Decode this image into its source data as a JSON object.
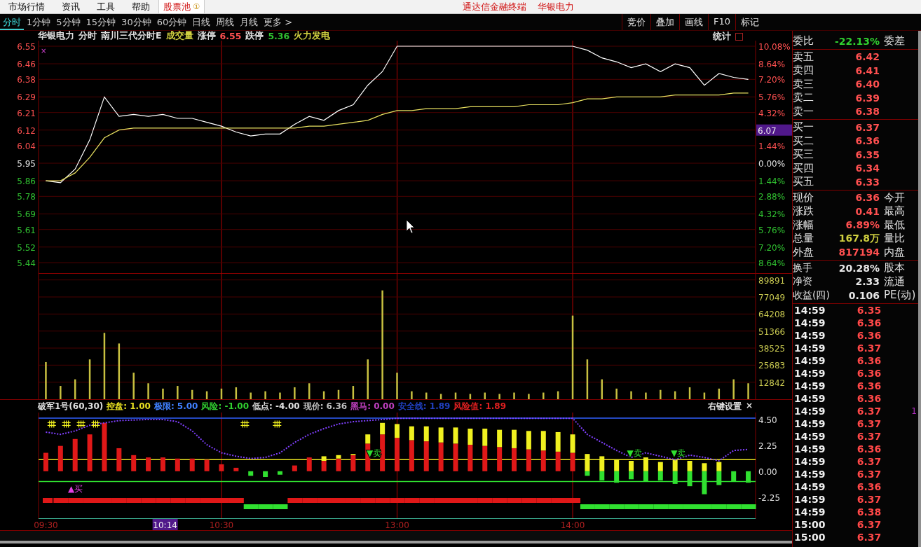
{
  "menu_bar": {
    "items": [
      "市场行情",
      "资讯",
      "工具",
      "帮助"
    ],
    "pool": {
      "label": "股票池",
      "badge": "①"
    },
    "titles": [
      "通达信金融终端",
      "华银电力"
    ]
  },
  "period_tabs": [
    {
      "label": "分时",
      "selected": true
    },
    {
      "label": "1分钟",
      "selected": false
    },
    {
      "label": "5分钟",
      "selected": false
    },
    {
      "label": "15分钟",
      "selected": false
    },
    {
      "label": "30分钟",
      "selected": false
    },
    {
      "label": "60分钟",
      "selected": false
    },
    {
      "label": "日线",
      "selected": false
    },
    {
      "label": "周线",
      "selected": false
    },
    {
      "label": "月线",
      "selected": false
    },
    {
      "label": "更多 >",
      "selected": false
    }
  ],
  "tool_buttons": [
    "竞价",
    "叠加",
    "画线",
    "F10",
    "标记"
  ],
  "chart_header": {
    "items": [
      {
        "text": "华银电力",
        "kind": "label"
      },
      {
        "text": "分时",
        "kind": "label"
      },
      {
        "text": "南川三代分时E",
        "kind": "label"
      },
      {
        "text": "成交量",
        "kind": "volume"
      },
      {
        "text": "涨停",
        "kind": "label"
      },
      {
        "text": "6.55",
        "kind": "up"
      },
      {
        "text": "跌停",
        "kind": "label"
      },
      {
        "text": "5.36",
        "kind": "down"
      },
      {
        "text": "火力发电",
        "kind": "volume"
      }
    ],
    "stats_label": "统计"
  },
  "price_panel": {
    "corner_mark": "×",
    "right_axis": [
      {
        "label": "10.08%",
        "kind": "up"
      },
      {
        "label": "8.64%",
        "kind": "up"
      },
      {
        "label": "7.20%",
        "kind": "up"
      },
      {
        "label": "5.76%",
        "kind": "up"
      },
      {
        "label": "4.32%",
        "kind": "up"
      },
      {
        "label": "6.07",
        "kind": "cursor"
      },
      {
        "label": "1.44%",
        "kind": "up"
      },
      {
        "label": "0.00%",
        "kind": "flat"
      },
      {
        "label": "1.44%",
        "kind": "down"
      },
      {
        "label": "2.88%",
        "kind": "down"
      },
      {
        "label": "4.32%",
        "kind": "down"
      },
      {
        "label": "5.76%",
        "kind": "down"
      },
      {
        "label": "7.20%",
        "kind": "down"
      },
      {
        "label": "8.64%",
        "kind": "down"
      }
    ],
    "chart_data": {
      "type": "line",
      "grid": true,
      "ylim": [
        5.44,
        6.55
      ],
      "yticks": [
        {
          "value": 6.55,
          "label": "6.55"
        },
        {
          "value": 6.46,
          "label": "6.46"
        },
        {
          "value": 6.38,
          "label": "6.38"
        },
        {
          "value": 6.29,
          "label": "6.29"
        },
        {
          "value": 6.21,
          "label": "6.21"
        },
        {
          "value": 6.12,
          "label": "6.12"
        },
        {
          "value": 6.04,
          "label": "6.04"
        },
        {
          "value": 5.95,
          "label": "5.95"
        },
        {
          "value": 5.86,
          "label": "5.86"
        },
        {
          "value": 5.78,
          "label": "5.78"
        },
        {
          "value": 5.69,
          "label": "5.69"
        },
        {
          "value": 5.61,
          "label": "5.61"
        },
        {
          "value": 5.52,
          "label": "5.52"
        },
        {
          "value": 5.44,
          "label": "5.44"
        }
      ],
      "series": [
        {
          "color": "#ffffff",
          "values": [
            5.86,
            5.85,
            5.92,
            6.07,
            6.29,
            6.19,
            6.2,
            6.19,
            6.2,
            6.18,
            6.18,
            6.16,
            6.14,
            6.11,
            6.09,
            6.1,
            6.1,
            6.15,
            6.19,
            6.17,
            6.22,
            6.25,
            6.35,
            6.42,
            6.55,
            6.55,
            6.55,
            6.55,
            6.55,
            6.55,
            6.55,
            6.55,
            6.55,
            6.55,
            6.55,
            6.55,
            6.55,
            6.53,
            6.49,
            6.47,
            6.44,
            6.46,
            6.42,
            6.46,
            6.44,
            6.35,
            6.41,
            6.39,
            6.38
          ]
        },
        {
          "color": "#e8e060",
          "values": [
            5.86,
            5.86,
            5.9,
            5.98,
            6.08,
            6.12,
            6.13,
            6.13,
            6.13,
            6.13,
            6.13,
            6.13,
            6.13,
            6.13,
            6.13,
            6.13,
            6.13,
            6.13,
            6.14,
            6.14,
            6.15,
            6.16,
            6.17,
            6.2,
            6.22,
            6.22,
            6.23,
            6.23,
            6.23,
            6.24,
            6.24,
            6.24,
            6.24,
            6.25,
            6.25,
            6.25,
            6.26,
            6.28,
            6.28,
            6.29,
            6.29,
            6.29,
            6.29,
            6.3,
            6.3,
            6.3,
            6.3,
            6.31,
            6.31
          ]
        }
      ]
    }
  },
  "volume_panel": {
    "chart_data": {
      "type": "bar",
      "grid": true,
      "ylim": [
        0,
        95000
      ],
      "yticks": [
        {
          "value": 89891,
          "label": "89891"
        },
        {
          "value": 77049,
          "label": "77049"
        },
        {
          "value": 64208,
          "label": "64208"
        },
        {
          "value": 51366,
          "label": "51366"
        },
        {
          "value": 38525,
          "label": "38525"
        },
        {
          "value": 25683,
          "label": "25683"
        },
        {
          "value": 12842,
          "label": "12842"
        }
      ],
      "series": [
        {
          "color": "#c8c040",
          "values": [
            28000,
            10000,
            15000,
            30000,
            50000,
            42000,
            20000,
            12000,
            8000,
            10000,
            7000,
            6000,
            8000,
            9000,
            5000,
            6000,
            5000,
            9000,
            12000,
            6000,
            7000,
            10000,
            30000,
            82000,
            20000,
            6000,
            5000,
            4000,
            5000,
            4000,
            5000,
            4000,
            5000,
            4000,
            5000,
            6000,
            63000,
            30000,
            15000,
            8000,
            6000,
            5000,
            7000,
            6000,
            9000,
            5000,
            8000,
            15000,
            12000
          ]
        }
      ]
    }
  },
  "indicator": {
    "items": [
      {
        "text": "破军1号(60,30)",
        "kind": "name"
      },
      {
        "text": "控盘: 1.00",
        "kind": "control"
      },
      {
        "text": "极限: 5.00",
        "kind": "limit"
      },
      {
        "text": "风险: -1.00",
        "kind": "risk"
      },
      {
        "text": "低点: -4.00",
        "kind": "low"
      },
      {
        "text": "现价: 6.36",
        "kind": "price"
      },
      {
        "text": "黑马: 0.00",
        "kind": "horse"
      },
      {
        "text": "安全线: 1.89",
        "kind": "safe"
      },
      {
        "text": "风险值: 1.89",
        "kind": "riskvalue"
      }
    ],
    "settings_label": "右键设置",
    "close_label": "×",
    "cursor_time": "10:14",
    "chart_data": {
      "type": "bar",
      "stacked": true,
      "grid": true,
      "ylim": [
        -4.15,
        5.1
      ],
      "yticks": [
        {
          "value": 4.5,
          "label": "4.50"
        },
        {
          "value": 2.25,
          "label": "2.25"
        },
        {
          "value": 0,
          "label": "0.00"
        },
        {
          "value": -2.25,
          "label": "-2.25"
        }
      ],
      "categories": [
        "09:30",
        null,
        null,
        null,
        null,
        null,
        null,
        null,
        null,
        null,
        null,
        null,
        "10:30",
        null,
        null,
        null,
        null,
        null,
        null,
        null,
        null,
        null,
        null,
        null,
        "13:00",
        null,
        null,
        null,
        null,
        null,
        null,
        null,
        null,
        null,
        null,
        null,
        "14:00",
        null,
        null,
        null,
        null,
        null,
        null,
        null,
        null,
        null,
        null,
        null,
        null
      ],
      "series": [
        {
          "color": "#e01818",
          "values": [
            1.6,
            2.2,
            2.8,
            3.2,
            4.2,
            2.0,
            1.4,
            1.2,
            1.2,
            1.1,
            1.1,
            1.0,
            0.6,
            0.3,
            0,
            0,
            0,
            0.5,
            1.2,
            0.9,
            1.1,
            1.4,
            2.4,
            3.2,
            2.9,
            2.7,
            2.6,
            2.5,
            2.4,
            2.3,
            2.2,
            2.1,
            2.0,
            1.9,
            1.8,
            1.7,
            1.6,
            0,
            0,
            0,
            0,
            0,
            0,
            0,
            0,
            0,
            0,
            0,
            0
          ]
        },
        {
          "color": "#f0f020",
          "values": [
            0,
            0,
            0,
            0,
            0,
            0,
            0,
            0,
            0,
            0,
            0,
            0,
            0,
            0,
            0,
            0,
            0,
            0,
            0,
            0.4,
            0.3,
            0.1,
            0.8,
            1.0,
            1.2,
            1.2,
            1.3,
            1.3,
            1.4,
            1.4,
            1.5,
            1.5,
            1.6,
            1.6,
            1.7,
            1.7,
            1.6,
            1.5,
            1.3,
            1.0,
            0.9,
            1.2,
            0.8,
            1.0,
            0.9,
            0.7,
            0.8,
            0,
            0
          ]
        },
        {
          "color": "#30e030",
          "values": [
            0,
            0,
            0,
            0,
            0,
            0,
            0,
            0,
            0,
            0,
            0,
            0,
            0,
            0,
            -0.4,
            -0.5,
            -0.3,
            0,
            0,
            0,
            0,
            0,
            0,
            0,
            0,
            0,
            0,
            0,
            0,
            0,
            0,
            0,
            0,
            0,
            0,
            0,
            0,
            -0.4,
            -0.8,
            -1.0,
            -0.7,
            -0.9,
            -0.8,
            -1.1,
            -1.3,
            -2.0,
            -1.2,
            -0.9,
            -1.0
          ]
        },
        {
          "type": "line",
          "color": "#8040ff",
          "line_style": "dashed",
          "values": [
            3.4,
            3.2,
            3.5,
            4.0,
            4.2,
            4.4,
            4.45,
            4.5,
            4.5,
            4.3,
            3.5,
            2.3,
            1.6,
            1.3,
            1.1,
            1.2,
            1.6,
            2.5,
            3.2,
            3.7,
            4.1,
            4.3,
            4.4,
            4.5,
            4.6,
            4.6,
            4.6,
            4.6,
            4.6,
            4.6,
            4.6,
            4.6,
            4.6,
            4.6,
            4.6,
            4.6,
            4.6,
            3.2,
            2.5,
            1.8,
            1.2,
            1.6,
            1.3,
            1.0,
            1.4,
            1.2,
            0.9,
            1.8,
            1.9
          ]
        }
      ],
      "ref_lines": [
        {
          "axis": "y",
          "value": 4.62,
          "color": "#3060ff"
        },
        {
          "axis": "y",
          "value": 1.0,
          "color": "#e8e020"
        },
        {
          "axis": "y",
          "value": -0.9,
          "color": "#30e030"
        }
      ],
      "annotations": [
        {
          "y": 1.0,
          "text": "▼卖"
        },
        {
          "y": 1.0,
          "text": "▼卖"
        },
        {
          "y": 1.0,
          "text": "▼卖"
        },
        {
          "y": -0.9,
          "text": "▲买"
        }
      ]
    }
  },
  "order_book": {
    "summary": {
      "label": "委比",
      "value": "-22.13%",
      "label2": "委差"
    },
    "asks": [
      {
        "label": "卖五",
        "price": "6.42"
      },
      {
        "label": "卖四",
        "price": "6.41"
      },
      {
        "label": "卖三",
        "price": "6.40"
      },
      {
        "label": "卖二",
        "price": "6.39"
      },
      {
        "label": "卖一",
        "price": "6.38"
      }
    ],
    "bids": [
      {
        "label": "买一",
        "price": "6.37"
      },
      {
        "label": "买二",
        "price": "6.36"
      },
      {
        "label": "买三",
        "price": "6.35"
      },
      {
        "label": "买四",
        "price": "6.34"
      },
      {
        "label": "买五",
        "price": "6.33"
      }
    ]
  },
  "quote": [
    {
      "label": "现价",
      "value": "6.36",
      "label2": "今开",
      "kind": "up"
    },
    {
      "label": "涨跌",
      "value": "0.41",
      "label2": "最高",
      "kind": "up"
    },
    {
      "label": "涨幅",
      "value": "6.89%",
      "label2": "最低",
      "kind": "up"
    },
    {
      "label": "总量",
      "value": "167.8万",
      "label2": "量比",
      "kind": "volume"
    },
    {
      "label": "外盘",
      "value": "817194",
      "label2": "内盘",
      "kind": "up"
    }
  ],
  "stats": [
    {
      "label": "换手",
      "value": "20.28%",
      "label2": "股本"
    },
    {
      "label": "净资",
      "value": "2.33",
      "label2": "流通"
    },
    {
      "label": "收益(四)",
      "value": "0.106",
      "label2": "PE(动)"
    }
  ],
  "trades": [
    {
      "time": "14:59",
      "price": "6.35"
    },
    {
      "time": "14:59",
      "price": "6.36"
    },
    {
      "time": "14:59",
      "price": "6.36"
    },
    {
      "time": "14:59",
      "price": "6.37"
    },
    {
      "time": "14:59",
      "price": "6.36"
    },
    {
      "time": "14:59",
      "price": "6.36"
    },
    {
      "time": "14:59",
      "price": "6.36"
    },
    {
      "time": "14:59",
      "price": "6.36"
    },
    {
      "time": "14:59",
      "price": "6.37",
      "flag": "1"
    },
    {
      "time": "14:59",
      "price": "6.37"
    },
    {
      "time": "14:59",
      "price": "6.37"
    },
    {
      "time": "14:59",
      "price": "6.36"
    },
    {
      "time": "14:59",
      "price": "6.37"
    },
    {
      "time": "14:59",
      "price": "6.37"
    },
    {
      "time": "14:59",
      "price": "6.36"
    },
    {
      "time": "14:59",
      "price": "6.37"
    },
    {
      "time": "14:59",
      "price": "6.38"
    },
    {
      "time": "15:00",
      "price": "6.37"
    },
    {
      "time": "15:00",
      "price": "6.37"
    }
  ]
}
